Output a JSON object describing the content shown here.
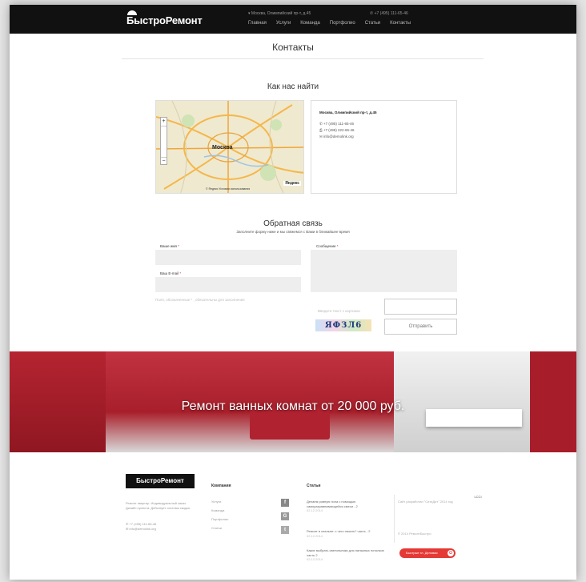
{
  "header": {
    "logo": "БыстроРемонт",
    "address": "Москва, Олимпийский пр-т, д.45",
    "phone": "+7 (495) 111-65-46",
    "nav": [
      "Главная",
      "Услуги",
      "Команда",
      "Портфолио",
      "Статьи",
      "Контакты"
    ]
  },
  "contacts": {
    "title": "Контакты",
    "find_title": "Как нас найти",
    "map": {
      "city": "Москва",
      "zoom_in": "+",
      "zoom_out": "−",
      "footer": "© Яндекс   Условия использования",
      "brand": "Яндекс"
    },
    "card": {
      "address": "Москва, Олимпийский пр-т, д.45",
      "phone": "+7 (495) 111-65-46",
      "fax": "+7 (495) 222-65-46",
      "email": "info@demolink.org"
    }
  },
  "feedback": {
    "title": "Обратная связь",
    "subtitle": "Заполните форму ниже и мы свяжемся с Вами в ближайшее время",
    "name_label": "Ваше имя",
    "email_label": "Ваш E-mail",
    "message_label": "Сообщение",
    "required_mark": "*",
    "hint": "Поля, обозначенные * , обязательны для заполнения",
    "captcha_label": "Введите текст с картинки",
    "captcha_text": "ЯФЗЛ6",
    "send_label": "Отправить"
  },
  "banner": {
    "text": "Ремонт ванных комнат от 20 000 руб."
  },
  "footer": {
    "logo": "БыстроРемонт",
    "about": "Ремонт квартир. Индивидуальный заказ. Дизайн проекта. Действует система скидок.",
    "phone": "+7 (495) 111-65-46",
    "email": "info@demolink.org",
    "company_title": "Компания",
    "company_links": [
      "Услуги",
      "Команда",
      "Портфолио",
      "Статьи"
    ],
    "social": [
      "f",
      "G",
      "t"
    ],
    "articles_title": "Статьи",
    "articles": [
      {
        "title": "Делаем ровную пола с помощью саморазравнивающейся смеси - 2",
        "date": "02.12.2014"
      },
      {
        "title": "Ремонт в спальне: с чего начать? часть - 2",
        "date": "02.12.2014"
      },
      {
        "title": "Какие выбрать светильники для натяжных потолков часть 2",
        "date": "02.12.2014"
      }
    ],
    "side_text": "Сайт разработан \"СитиДит\" 2014 год",
    "copyright": "© 2014 РемонтБыстро",
    "cta_label": "Быстрые гл. Деловая",
    "lcc_label": "LCCI"
  }
}
